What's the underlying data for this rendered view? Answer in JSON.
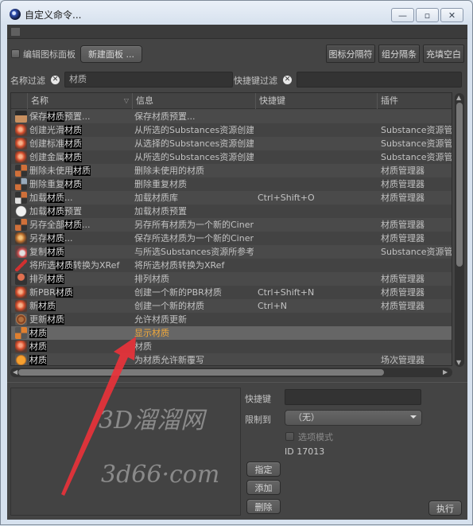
{
  "window": {
    "title": "自定义命令...",
    "controls": {
      "minimize": "—",
      "maximize": "▫",
      "close": "✕"
    }
  },
  "toolbar": {
    "edit_icon_palette_label": "编辑图标面板",
    "new_palette_button": "新建面板 ...",
    "icon_separator_button": "图标分隔符",
    "group_separator_button": "组分隔条",
    "fill_space_button": "充填空白"
  },
  "filters": {
    "name_filter_label": "名称过滤",
    "name_filter_value": "材质",
    "shortcut_filter_label": "快捷键过滤",
    "shortcut_filter_value": ""
  },
  "table": {
    "columns": [
      "名称",
      "信息",
      "快捷键",
      "插件"
    ],
    "rows": [
      {
        "icon": "save-material-preset-icon",
        "name_pre": "保存",
        "name_hl": "材质",
        "name_post": "预置...",
        "info": "保存材质预置...",
        "shortcut": "",
        "plugin": ""
      },
      {
        "icon": "create-material-icon",
        "name_pre": "创建光滑",
        "name_hl": "材质",
        "name_post": "",
        "info": "从所选的Substances资源创建光",
        "shortcut": "",
        "plugin": "Substance资源管理器"
      },
      {
        "icon": "create-material-icon",
        "name_pre": "创建标准",
        "name_hl": "材质",
        "name_post": "",
        "info": "从选择的Substances资源创建标",
        "shortcut": "",
        "plugin": "Substance资源管理器"
      },
      {
        "icon": "create-material-icon",
        "name_pre": "创建金属",
        "name_hl": "材质",
        "name_post": "",
        "info": "从所选的Substances资源创建金",
        "shortcut": "",
        "plugin": "Substance资源管理器"
      },
      {
        "icon": "delete-unused-materials-icon",
        "name_pre": "删除未使用",
        "name_hl": "材质",
        "name_post": "",
        "info": "删除未使用的材质",
        "shortcut": "",
        "plugin": "材质管理器"
      },
      {
        "icon": "delete-duplicate-materials-icon",
        "name_pre": "删除重复",
        "name_hl": "材质",
        "name_post": "",
        "info": "删除重复材质",
        "shortcut": "",
        "plugin": "材质管理器"
      },
      {
        "icon": "load-materials-icon",
        "name_pre": "加载",
        "name_hl": "材质",
        "name_post": "...",
        "info": "加载材质库",
        "shortcut": "Ctrl+Shift+O",
        "plugin": "材质管理器"
      },
      {
        "icon": "load-material-preset-icon",
        "name_pre": "加载",
        "name_hl": "材质",
        "name_post": "预置",
        "info": "加载材质预置",
        "shortcut": "",
        "plugin": ""
      },
      {
        "icon": "save-all-materials-icon",
        "name_pre": "另存全部",
        "name_hl": "材质",
        "name_post": "...",
        "info": "另存所有材质为一个新的Cinema",
        "shortcut": "",
        "plugin": "材质管理器"
      },
      {
        "icon": "save-material-as-icon",
        "name_pre": "另存",
        "name_hl": "材质",
        "name_post": "...",
        "info": "保存所选材质为一个新的Cinema",
        "shortcut": "",
        "plugin": "材质管理器"
      },
      {
        "icon": "duplicate-material-icon",
        "name_pre": "复制",
        "name_hl": "材质",
        "name_post": "",
        "info": "与所选Substances资源所参考的",
        "shortcut": "",
        "plugin": "Substance资源管理器"
      },
      {
        "icon": "convert-xref-icon",
        "name_pre": "将所选",
        "name_hl": "材质",
        "name_post": "转换为XRef",
        "info": "将所选材质转换为XRef",
        "shortcut": "",
        "plugin": ""
      },
      {
        "icon": "sort-materials-icon",
        "name_pre": "排列",
        "name_hl": "材质",
        "name_post": "",
        "info": "排列材质",
        "shortcut": "",
        "plugin": "材质管理器"
      },
      {
        "icon": "new-pbr-material-icon",
        "name_pre": "新PBR",
        "name_hl": "材质",
        "name_post": "",
        "info": "创建一个新的PBR材质",
        "shortcut": "Ctrl+Shift+N",
        "plugin": "材质管理器"
      },
      {
        "icon": "new-material-icon",
        "name_pre": "新",
        "name_hl": "材质",
        "name_post": "",
        "info": "创建一个新的材质",
        "shortcut": "Ctrl+N",
        "plugin": "材质管理器"
      },
      {
        "icon": "update-material-icon",
        "name_pre": "更新",
        "name_hl": "材质",
        "name_post": "",
        "info": "允许材质更新",
        "shortcut": "",
        "plugin": ""
      },
      {
        "icon": "show-materials-icon",
        "name_pre": "",
        "name_hl": "材质",
        "name_post": "",
        "info": "显示材质",
        "shortcut": "",
        "plugin": "",
        "selected": true
      },
      {
        "icon": "material-tag-icon",
        "name_pre": "",
        "name_hl": "材质",
        "name_post": "",
        "info": "材质",
        "shortcut": "",
        "plugin": ""
      },
      {
        "icon": "material-override-icon",
        "name_pre": "",
        "name_hl": "材质",
        "name_post": "",
        "info": "为材质允许新覆写",
        "shortcut": "",
        "plugin": "场次管理器"
      }
    ]
  },
  "details": {
    "shortcut_label": "快捷键",
    "shortcut_value": "",
    "restrict_label": "限制到",
    "restrict_value": "（无）",
    "option_mode_label": "选项模式",
    "id_text": "ID 17013",
    "assign_button": "指定",
    "add_button": "添加",
    "remove_button": "删除",
    "execute_button": "执行"
  },
  "watermark": {
    "line1": "3D溜溜网",
    "line2": "3d66·com"
  },
  "colors": {
    "accent": "#f2a93b",
    "annotation_arrow": "#e8323a"
  }
}
